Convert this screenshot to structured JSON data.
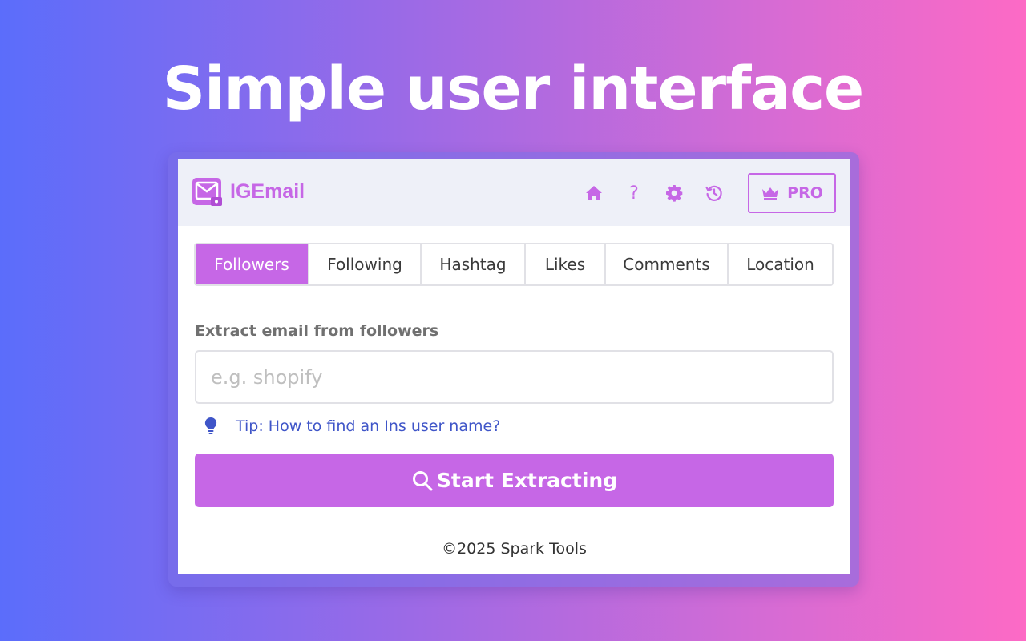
{
  "hero": {
    "title": "Simple user interface"
  },
  "app": {
    "name": "IGEmail"
  },
  "header": {
    "icons": [
      "home-icon",
      "help-icon",
      "gear-icon",
      "history-icon"
    ],
    "help_glyph": "?",
    "pro_label": "PRO"
  },
  "tabs": [
    {
      "label": "Followers",
      "active": true
    },
    {
      "label": "Following",
      "active": false
    },
    {
      "label": "Hashtag",
      "active": false
    },
    {
      "label": "Likes",
      "active": false
    },
    {
      "label": "Comments",
      "active": false
    },
    {
      "label": "Location",
      "active": false
    }
  ],
  "form": {
    "label": "Extract email from followers",
    "input_value": "",
    "input_placeholder": "e.g. shopify",
    "tip_text": "Tip: How to find an Ins user name?",
    "submit_label": "Start Extracting"
  },
  "footer": {
    "text": "©2025 Spark Tools"
  },
  "colors": {
    "accent": "#c667e6",
    "header_bg": "#eef0f8",
    "link": "#3f55c8",
    "gradient_start": "#5b6dfb",
    "gradient_end": "#fd6ac5"
  }
}
